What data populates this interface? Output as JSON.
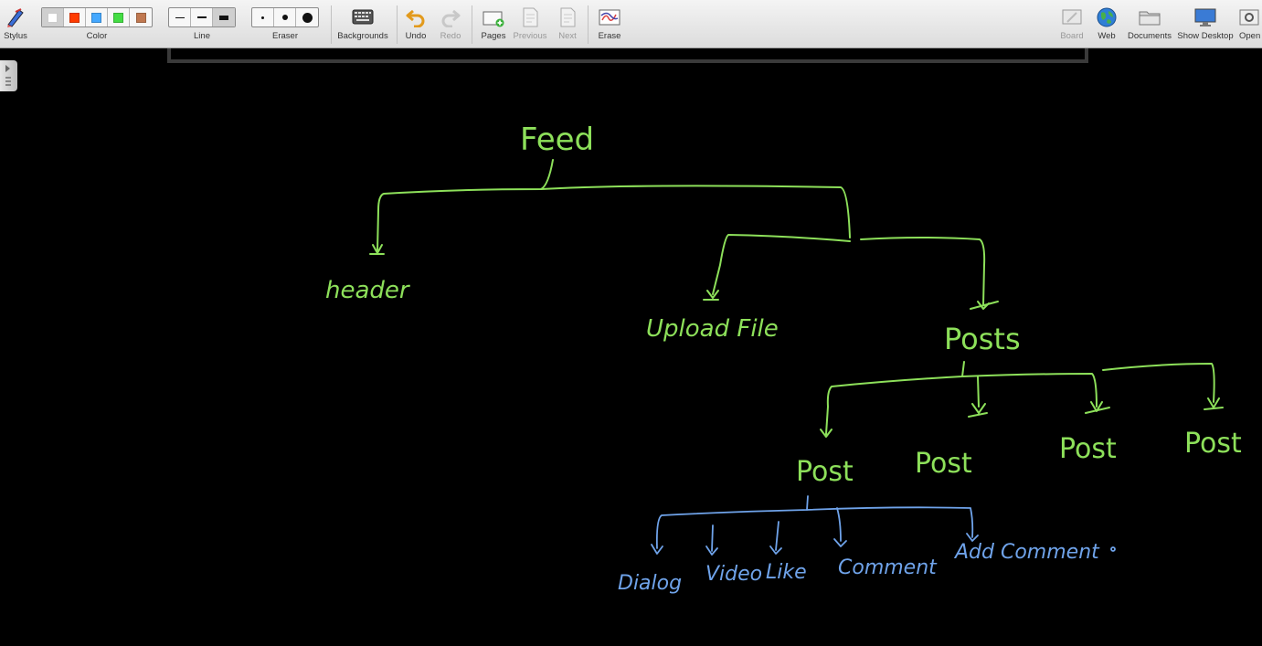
{
  "toolbar": {
    "stylus": "Stylus",
    "color": "Color",
    "line": "Line",
    "eraser": "Eraser",
    "backgrounds": "Backgrounds",
    "undo": "Undo",
    "redo": "Redo",
    "pages": "Pages",
    "previous": "Previous",
    "next": "Next",
    "erase": "Erase",
    "board": "Board",
    "web": "Web",
    "documents": "Documents",
    "show_desktop": "Show Desktop",
    "open": "Open"
  },
  "colors": {
    "swatches": [
      "#ffffff",
      "#ff3b00",
      "#44a8ff",
      "#44dd44",
      "#c07850"
    ],
    "green_ink": "#8de05a",
    "blue_ink": "#6fa3ea"
  },
  "drawing": {
    "feed": "Feed",
    "header": "header",
    "upload_file": "Upload File",
    "posts": "Posts",
    "post": [
      "Post",
      "Post",
      "Post",
      "Post"
    ],
    "dialog": "Dialog",
    "video": "Video",
    "like": "Like",
    "comment": "Comment",
    "add_comment": "Add Comment"
  }
}
